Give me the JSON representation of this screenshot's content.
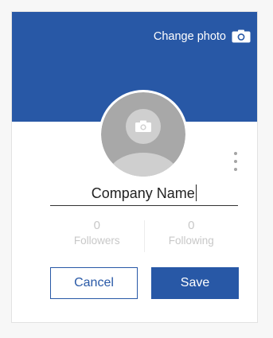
{
  "header": {
    "change_photo_label": "Change photo",
    "change_photo_icon": "camera-icon",
    "background_color": "#2858a6"
  },
  "avatar": {
    "icon": "person-silhouette-icon",
    "overlay_icon": "camera-icon"
  },
  "menu": {
    "icon": "kebab-menu-icon"
  },
  "name_field": {
    "value": "Company Name"
  },
  "stats": [
    {
      "count": "0",
      "label": "Followers"
    },
    {
      "count": "0",
      "label": "Following"
    }
  ],
  "actions": {
    "cancel_label": "Cancel",
    "save_label": "Save"
  },
  "colors": {
    "accent": "#2858a6",
    "muted_text": "#c8c8c8"
  }
}
